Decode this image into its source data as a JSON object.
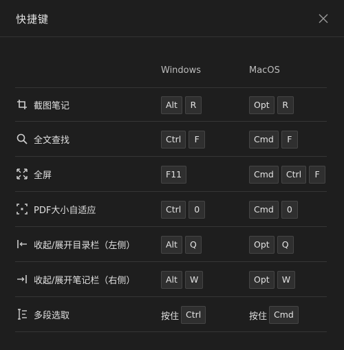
{
  "dialog": {
    "title": "快捷键",
    "close_icon": "close-icon"
  },
  "columns": {
    "windows": "Windows",
    "macos": "MacOS"
  },
  "shortcuts": [
    {
      "icon": "crop-icon",
      "label": "截图笔记",
      "windows": {
        "prefix": "",
        "keys": [
          "Alt",
          "R"
        ]
      },
      "macos": {
        "prefix": "",
        "keys": [
          "Opt",
          "R"
        ]
      }
    },
    {
      "icon": "search-icon",
      "label": "全文查找",
      "windows": {
        "prefix": "",
        "keys": [
          "Ctrl",
          "F"
        ]
      },
      "macos": {
        "prefix": "",
        "keys": [
          "Cmd",
          "F"
        ]
      }
    },
    {
      "icon": "fullscreen-icon",
      "label": "全屏",
      "windows": {
        "prefix": "",
        "keys": [
          "F11"
        ]
      },
      "macos": {
        "prefix": "",
        "keys": [
          "Cmd",
          "Ctrl",
          "F"
        ]
      }
    },
    {
      "icon": "fit-page-icon",
      "label": "PDF大小自适应",
      "windows": {
        "prefix": "",
        "keys": [
          "Ctrl",
          "0"
        ]
      },
      "macos": {
        "prefix": "",
        "keys": [
          "Cmd",
          "0"
        ]
      }
    },
    {
      "icon": "collapse-left-icon",
      "label": "收起/展开目录栏（左侧）",
      "windows": {
        "prefix": "",
        "keys": [
          "Alt",
          "Q"
        ]
      },
      "macos": {
        "prefix": "",
        "keys": [
          "Opt",
          "Q"
        ]
      }
    },
    {
      "icon": "collapse-right-icon",
      "label": "收起/展开笔记栏（右侧）",
      "windows": {
        "prefix": "",
        "keys": [
          "Alt",
          "W"
        ]
      },
      "macos": {
        "prefix": "",
        "keys": [
          "Opt",
          "W"
        ]
      }
    },
    {
      "icon": "multi-select-icon",
      "label": "多段选取",
      "windows": {
        "prefix": "按住",
        "keys": [
          "Ctrl"
        ]
      },
      "macos": {
        "prefix": "按住",
        "keys": [
          "Cmd"
        ]
      }
    }
  ]
}
